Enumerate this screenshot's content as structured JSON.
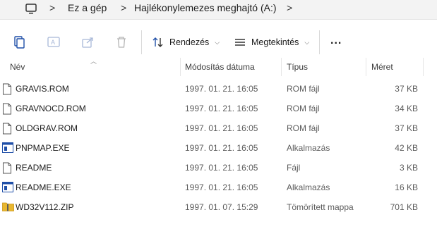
{
  "breadcrumb": {
    "items": [
      "Ez a gép",
      "Hajlékonylemezes meghajtó (A:)"
    ],
    "separator": ">"
  },
  "toolbar": {
    "sort_label": "Rendezés",
    "view_label": "Megtekintés",
    "more_label": "..."
  },
  "columns": {
    "name": "Név",
    "date": "Módosítás dátuma",
    "type": "Típus",
    "size": "Méret"
  },
  "files": [
    {
      "name": "GRAVIS.ROM",
      "date": "1997. 01. 21. 16:05",
      "type": "ROM fájl",
      "size": "37 KB",
      "icon": "document-icon"
    },
    {
      "name": "GRAVNOCD.ROM",
      "date": "1997. 01. 21. 16:05",
      "type": "ROM fájl",
      "size": "34 KB",
      "icon": "document-icon"
    },
    {
      "name": "OLDGRAV.ROM",
      "date": "1997. 01. 21. 16:05",
      "type": "ROM fájl",
      "size": "37 KB",
      "icon": "document-icon"
    },
    {
      "name": "PNPMAP.EXE",
      "date": "1997. 01. 21. 16:05",
      "type": "Alkalmazás",
      "size": "42 KB",
      "icon": "application-icon"
    },
    {
      "name": "README",
      "date": "1997. 01. 21. 16:05",
      "type": "Fájl",
      "size": "3 KB",
      "icon": "document-icon"
    },
    {
      "name": "README.EXE",
      "date": "1997. 01. 21. 16:05",
      "type": "Alkalmazás",
      "size": "16 KB",
      "icon": "application-icon"
    },
    {
      "name": "WD32V112.ZIP",
      "date": "1997. 01. 07. 15:29",
      "type": "Tömörített mappa",
      "size": "701 KB",
      "icon": "zip-folder-icon"
    }
  ],
  "colors": {
    "accent": "#1f4fa8",
    "zip": "#e8b730"
  }
}
